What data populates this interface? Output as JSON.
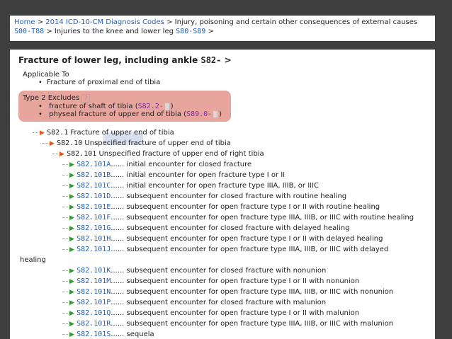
{
  "breadcrumb": {
    "home": "Home",
    "sep": ">",
    "year": "2014 ICD-10-CM Diagnosis Codes",
    "chapter": "Injury, poisoning and certain other consequences of external causes",
    "chapter_code": "S00-T88",
    "block": "Injuries to the knee and lower leg",
    "block_code": "S80-S89",
    "end": ">"
  },
  "page": {
    "title": "Fracture of lower leg, including ankle",
    "title_code": "S82-",
    "title_arrow": ">",
    "applicable_label": "Applicable To",
    "applicable_items": [
      "Fracture of proximal end of tibia"
    ],
    "excludes_label": "Type 2 Excludes",
    "excludes_help": "?",
    "excludes_items": [
      {
        "text": "fracture of shaft of tibia (",
        "code": "S82.2-",
        "close": ")"
      },
      {
        "text": "physeal fracture of upper end of tibia (",
        "code": "S89.0-",
        "close": ")"
      }
    ],
    "tree": {
      "l1_code": "S82.1",
      "l1_text": "Fracture of upper end of tibia",
      "l2_code": "S82.10",
      "l2_text": "Unspecified fracture of upper end of tibia",
      "l3_code": "S82.101",
      "l3_text": "Unspecified fracture of upper end of right tibia",
      "items": [
        {
          "code": "S82.101A",
          "desc": "initial encounter for closed fracture"
        },
        {
          "code": "S82.101B",
          "desc": "initial encounter for open fracture type I or II"
        },
        {
          "code": "S82.101C",
          "desc": "initial encounter for open fracture type IIIA, IIIB, or IIIC"
        },
        {
          "code": "S82.101D",
          "desc": "subsequent encounter for closed fracture with routine healing"
        },
        {
          "code": "S82.101E",
          "desc": "subsequent encounter for open fracture type I or II with routine healing"
        },
        {
          "code": "S82.101F",
          "desc": "subsequent encounter for open fracture type IIIA, IIIB, or IIIC with routine healing"
        },
        {
          "code": "S82.101G",
          "desc": "subsequent encounter for closed fracture with delayed healing"
        },
        {
          "code": "S82.101H",
          "desc": "subsequent encounter for open fracture type I or II with delayed healing"
        },
        {
          "code": "S82.101J",
          "desc": "subsequent encounter for open fracture type IIIA, IIIB, or IIIC with delayed"
        },
        {
          "code": "S82.101K",
          "desc": "subsequent encounter for closed fracture with nonunion"
        },
        {
          "code": "S82.101M",
          "desc": "subsequent encounter for open fracture type I or II with nonunion"
        },
        {
          "code": "S82.101N",
          "desc": "subsequent encounter for open fracture type IIIA, IIIB, or IIIC with nonunion"
        },
        {
          "code": "S82.101P",
          "desc": "subsequent encounter for closed fracture with malunion"
        },
        {
          "code": "S82.101Q",
          "desc": "subsequent encounter for open fracture type I or II with malunion"
        },
        {
          "code": "S82.101R",
          "desc": "subsequent encounter for open fracture type IIIA, IIIB, or IIIC with malunion"
        },
        {
          "code": "S82.101S",
          "desc": "sequela"
        }
      ],
      "wrap_text": "healing",
      "dots": "......"
    }
  },
  "colors": {
    "link": "#1f5fbf",
    "excludes_bg": "#e8a59e",
    "excludes_code": "#7a2aa6",
    "arrow_red": "#e0571f",
    "arrow_green": "#2e9a2e",
    "frame_bg": "#3f3f3f"
  },
  "icons": {
    "tree_arrow_open": "red-triangle-right-icon",
    "tree_arrow_leaf": "green-triangle-right-icon"
  }
}
